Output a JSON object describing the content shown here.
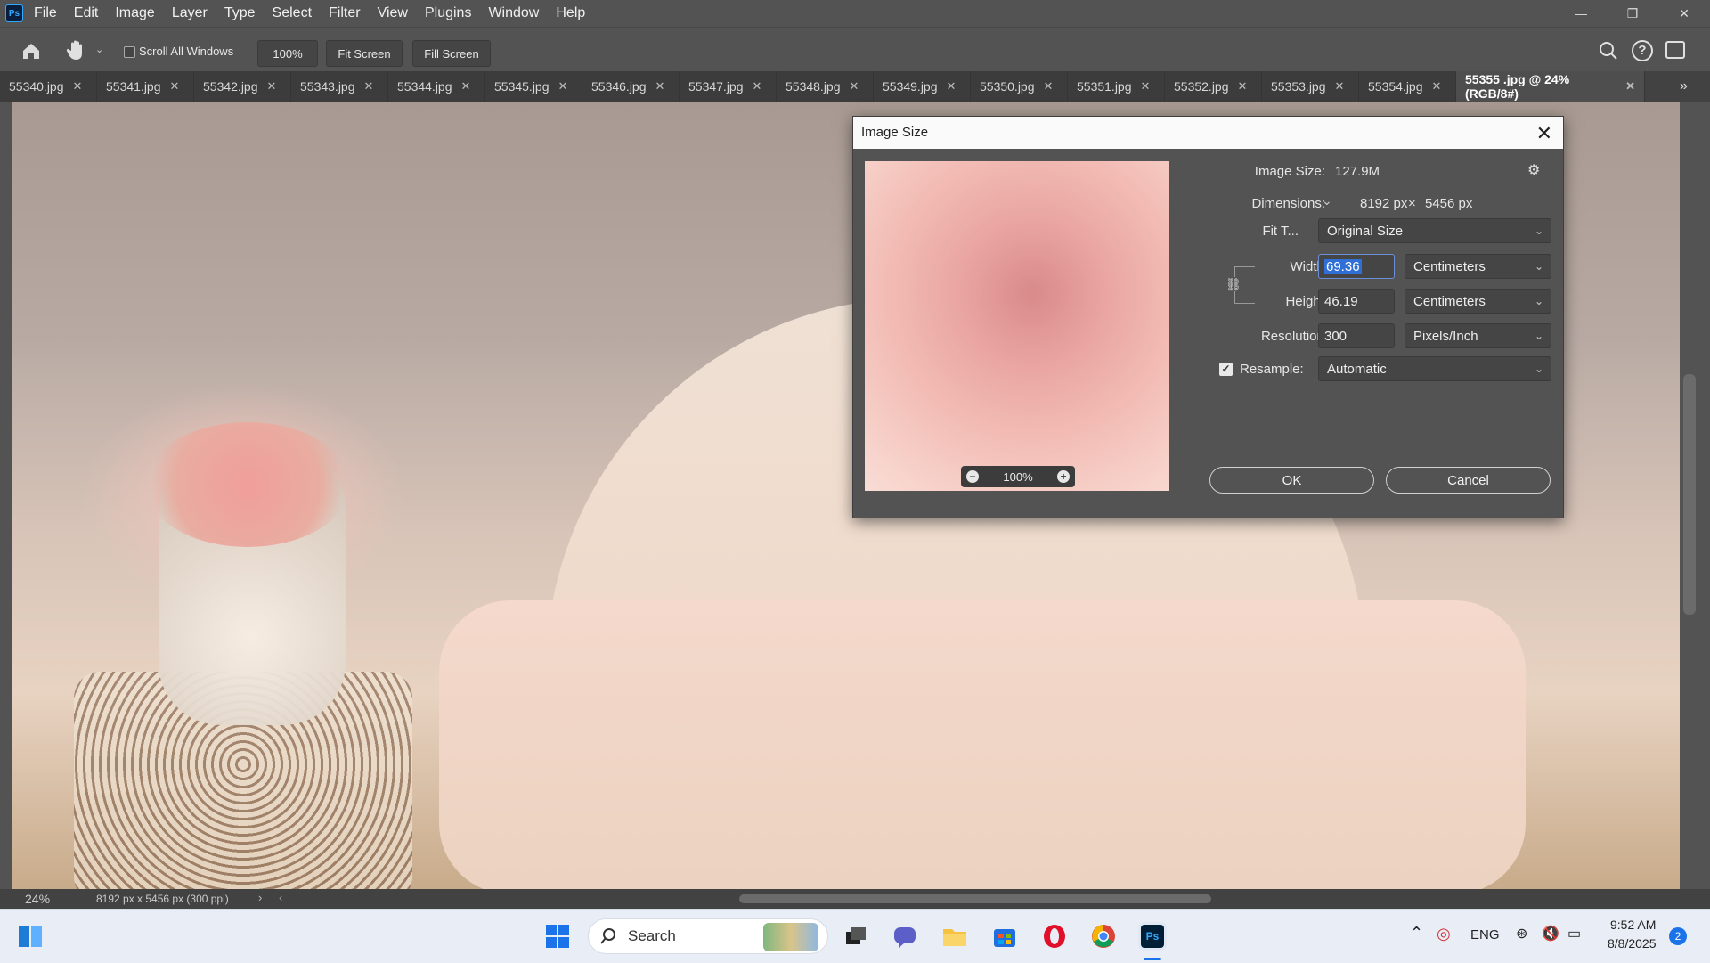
{
  "app": {
    "logo_text": "Ps"
  },
  "menu": [
    "File",
    "Edit",
    "Image",
    "Layer",
    "Type",
    "Select",
    "Filter",
    "View",
    "Plugins",
    "Window",
    "Help"
  ],
  "options_bar": {
    "scroll_all_windows": "Scroll All Windows",
    "zoom_100": "100%",
    "fit_screen": "Fit Screen",
    "fill_screen": "Fill Screen"
  },
  "tabs": [
    {
      "label": "55340.jpg"
    },
    {
      "label": "55341.jpg"
    },
    {
      "label": "55342.jpg"
    },
    {
      "label": "55343.jpg"
    },
    {
      "label": "55344.jpg"
    },
    {
      "label": "55345.jpg"
    },
    {
      "label": "55346.jpg"
    },
    {
      "label": "55347.jpg"
    },
    {
      "label": "55348.jpg"
    },
    {
      "label": "55349.jpg"
    },
    {
      "label": "55350.jpg"
    },
    {
      "label": "55351.jpg"
    },
    {
      "label": "55352.jpg"
    },
    {
      "label": "55353.jpg"
    },
    {
      "label": "55354.jpg"
    },
    {
      "label": "55355 .jpg @ 24% (RGB/8#)",
      "active": true
    }
  ],
  "status": {
    "zoom": "24%",
    "doc_info": "8192 px x 5456 px (300 ppi)"
  },
  "dialog": {
    "title": "Image Size",
    "image_size_label": "Image Size:",
    "image_size_value": "127.9M",
    "dimensions_label": "Dimensions:",
    "dim_width": "8192 px",
    "dim_x": "×",
    "dim_height": "5456 px",
    "fit_to_label": "Fit T...",
    "fit_to_value": "Original Size",
    "width_label": "Width:",
    "width_value": "69.36",
    "width_unit": "Centimeters",
    "height_label": "Height:",
    "height_value": "46.19",
    "height_unit": "Centimeters",
    "resolution_label": "Resolution:",
    "resolution_value": "300",
    "resolution_unit": "Pixels/Inch",
    "resample_label": "Resample:",
    "resample_checked": true,
    "resample_value": "Automatic",
    "preview_zoom": "100%",
    "ok": "OK",
    "cancel": "Cancel"
  },
  "taskbar": {
    "search_placeholder": "Search",
    "lang": "ENG",
    "time": "9:52 AM",
    "date": "8/8/2025",
    "notifications": "2"
  }
}
